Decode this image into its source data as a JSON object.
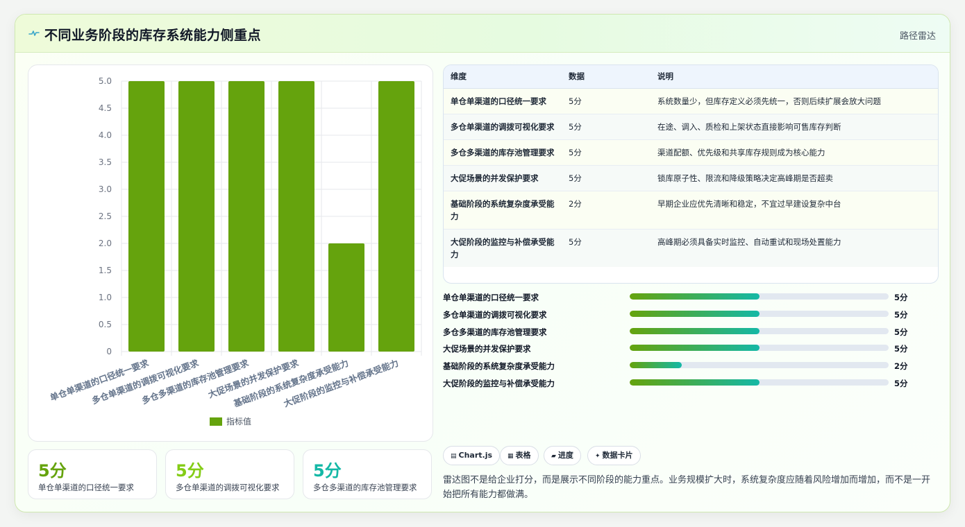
{
  "header": {
    "title": "不同业务阶段的库存系统能力侧重点",
    "tag": "路径雷达"
  },
  "table": {
    "headers": [
      "维度",
      "数据",
      "说明"
    ],
    "rows": [
      {
        "dim": "单仓单渠道的口径统一要求",
        "data": "5分",
        "desc": "系统数量少，但库存定义必须先统一，否则后续扩展会放大问题"
      },
      {
        "dim": "多仓单渠道的调拨可视化要求",
        "data": "5分",
        "desc": "在途、调入、质检和上架状态直接影响可售库存判断"
      },
      {
        "dim": "多仓多渠道的库存池管理要求",
        "data": "5分",
        "desc": "渠道配额、优先级和共享库存规则成为核心能力"
      },
      {
        "dim": "大促场景的并发保护要求",
        "data": "5分",
        "desc": "锁库原子性、限流和降级策略决定高峰期是否超卖"
      },
      {
        "dim": "基础阶段的系统复杂度承受能力",
        "data": "2分",
        "desc": "早期企业应优先清晰和稳定，不宜过早建设复杂中台"
      },
      {
        "dim": "大促阶段的监控与补偿承受能力",
        "data": "5分",
        "desc": "高峰期必须具备实时监控、自动重试和现场处置能力"
      }
    ]
  },
  "progress": {
    "max": 10,
    "items": [
      {
        "label": "单仓单渠道的口径统一要求",
        "value": 5,
        "text": "5分"
      },
      {
        "label": "多仓单渠道的调拨可视化要求",
        "value": 5,
        "text": "5分"
      },
      {
        "label": "多仓多渠道的库存池管理要求",
        "value": 5,
        "text": "5分"
      },
      {
        "label": "大促场景的并发保护要求",
        "value": 5,
        "text": "5分"
      },
      {
        "label": "基础阶段的系统复杂度承受能力",
        "value": 2,
        "text": "2分"
      },
      {
        "label": "大促阶段的监控与补偿承受能力",
        "value": 5,
        "text": "5分"
      }
    ]
  },
  "stats": [
    {
      "value": "5分",
      "label": "单仓单渠道的口径统一要求",
      "color": "#65a30d"
    },
    {
      "value": "5分",
      "label": "多仓单渠道的调拨可视化要求",
      "color": "#84cc16"
    },
    {
      "value": "5分",
      "label": "多仓多渠道的库存池管理要求",
      "color": "#14b8a6"
    }
  ],
  "chips": [
    {
      "icon": "▤",
      "label": "Chart.js"
    },
    {
      "icon": "▦",
      "label": "表格"
    },
    {
      "icon": "▰",
      "label": "进度"
    },
    {
      "icon": "✦",
      "label": "数据卡片"
    }
  ],
  "summary": "雷达图不是给企业打分，而是展示不同阶段的能力重点。业务规模扩大时，系统复杂度应随着风险增加而增加，而不是一开始把所有能力都做满。",
  "chart_data": {
    "type": "bar",
    "categories": [
      "单仓单渠道的口径统一要求",
      "多仓单渠道的调拨可视化要求",
      "多仓多渠道的库存池管理要求",
      "大促场景的并发保护要求",
      "基础阶段的系统复杂度承受能力",
      "大促阶段的监控与补偿承受能力"
    ],
    "series": [
      {
        "name": "指标值",
        "values": [
          5,
          5,
          5,
          5,
          2,
          5
        ]
      }
    ],
    "ylim": [
      0,
      5
    ],
    "yticks": [
      "0",
      "0.5",
      "1.0",
      "1.5",
      "2.0",
      "2.5",
      "3.0",
      "3.5",
      "4.0",
      "4.5",
      "5.0"
    ],
    "bar_color": "#65a30d",
    "grid": true,
    "legend": "bottom"
  }
}
